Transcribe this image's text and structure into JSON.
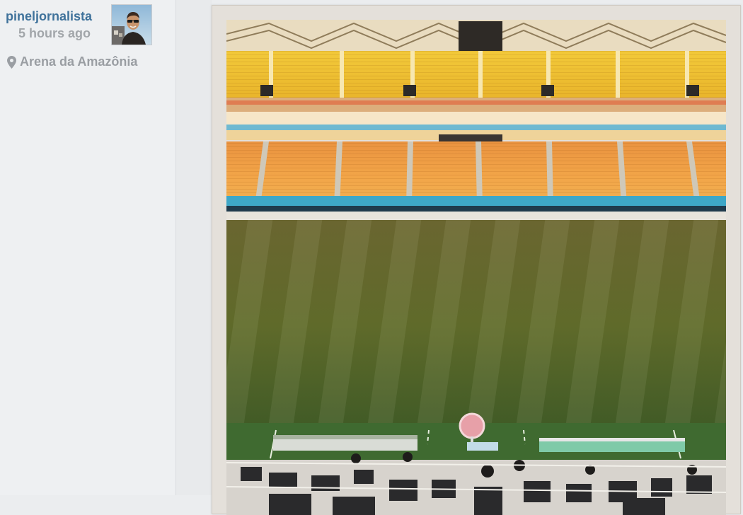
{
  "post": {
    "username": "pineljornalista",
    "timestamp": "5 hours ago",
    "location": "Arena da Amazônia"
  },
  "icons": {
    "location": "map-pin-icon",
    "avatar": "user-avatar-photo"
  },
  "colors": {
    "username": "#3f729b",
    "timestamp": "#a2a6aa",
    "location": "#9a9ea3",
    "sidebar_bg": "#eef0f2",
    "frame_bg": "#e4e0da"
  }
}
